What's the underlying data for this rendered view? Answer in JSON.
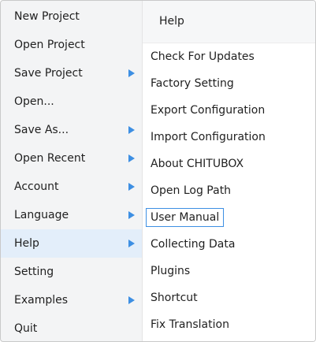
{
  "main_menu": {
    "items": [
      {
        "label": "New Project",
        "has_submenu": false
      },
      {
        "label": "Open Project",
        "has_submenu": false
      },
      {
        "label": "Save Project",
        "has_submenu": true
      },
      {
        "label": "Open...",
        "has_submenu": false
      },
      {
        "label": "Save As...",
        "has_submenu": true
      },
      {
        "label": "Open Recent",
        "has_submenu": true
      },
      {
        "label": "Account",
        "has_submenu": true
      },
      {
        "label": "Language",
        "has_submenu": true
      },
      {
        "label": "Help",
        "has_submenu": true,
        "active": true
      },
      {
        "label": "Setting",
        "has_submenu": false
      },
      {
        "label": "Examples",
        "has_submenu": true
      },
      {
        "label": "Quit",
        "has_submenu": false
      }
    ]
  },
  "submenu": {
    "title": "Help",
    "items": [
      {
        "label": "Check For Updates"
      },
      {
        "label": "Factory Setting"
      },
      {
        "label": "Export Configuration"
      },
      {
        "label": "Import Configuration"
      },
      {
        "label": "About CHITUBOX"
      },
      {
        "label": "Open Log Path"
      },
      {
        "label": "User Manual",
        "focused": true
      },
      {
        "label": "Collecting Data"
      },
      {
        "label": "Plugins"
      },
      {
        "label": "Shortcut"
      },
      {
        "label": "Fix Translation"
      }
    ]
  },
  "colors": {
    "accent": "#3d8fe3",
    "active_background": "#e3eefa"
  }
}
